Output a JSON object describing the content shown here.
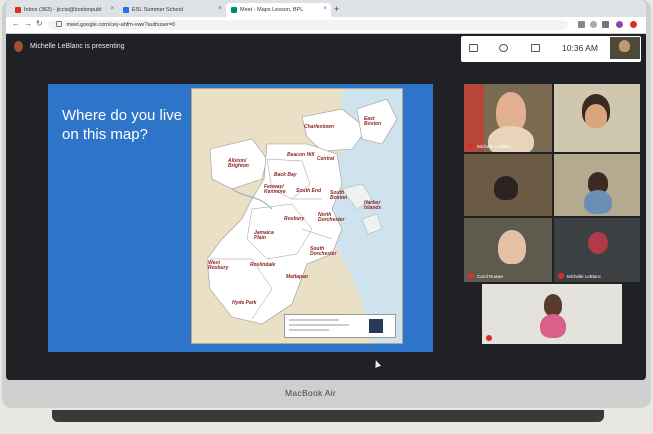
{
  "browser": {
    "tabs": [
      {
        "label": "Inbox (363) - jiccio@bostonpubl",
        "icon_color": "#d93025",
        "active": false
      },
      {
        "label": "ESL Summer School",
        "icon_color": "#1a73e8",
        "active": false
      },
      {
        "label": "Meet - Maps Lesson, BPL",
        "icon_color": "#00897b",
        "active": true
      }
    ],
    "tab_close": "×",
    "new_tab": "+",
    "url": "meet.google.com/cey-ahfm-vwe?authuser=0",
    "nav": {
      "back": "←",
      "forward": "→",
      "reload": "↻"
    }
  },
  "meet": {
    "presenter_text": "Michelle LeBlanc is presenting",
    "time": "10:36 AM",
    "slide": {
      "title": "Where do you live on this map?",
      "neighborhoods": [
        "Charlestown",
        "East Boston",
        "Allston/ Brighton",
        "Back Bay",
        "Beacon Hill",
        "Central",
        "Fenway/ Kenmore",
        "South End",
        "South Boston",
        "North Dorchester",
        "Harbor Islands",
        "Roxbury",
        "Jamaica Plain",
        "South Dorchester",
        "West Roxbury",
        "Roslindale",
        "Mattapan",
        "Hyde Park"
      ]
    },
    "participants": [
      {
        "name": "Michelle LeBlanc"
      },
      {
        "name": ""
      },
      {
        "name": ""
      },
      {
        "name": ""
      },
      {
        "name": "Carol Rowan"
      },
      {
        "name": "Michelle LeBlanc"
      },
      {
        "name": ""
      }
    ]
  },
  "laptop": {
    "brand": "MacBook Air"
  },
  "colors": {
    "slide_bg": "#2e74c8",
    "meet_bg": "#202124",
    "map_bg": "#f2ead7",
    "label": "#8b1e1e"
  }
}
